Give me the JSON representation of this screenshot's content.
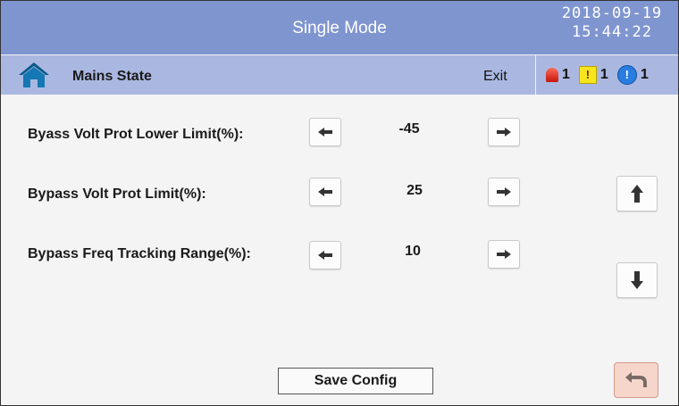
{
  "header": {
    "title": "Single Mode",
    "date": "2018-09-19",
    "time": "15:44:22"
  },
  "subheader": {
    "title": "Mains State",
    "exit_label": "Exit",
    "alarms": [
      {
        "icon": "red-alarm-icon",
        "count": "1"
      },
      {
        "icon": "yellow-warning-icon",
        "symbol": "!",
        "count": "1"
      },
      {
        "icon": "blue-info-icon",
        "symbol": "!",
        "count": "1"
      }
    ]
  },
  "settings": [
    {
      "label": "Byass Volt Prot Lower Limit(%):",
      "value": "-45"
    },
    {
      "label": "Bypass Volt Prot Limit(%):",
      "value": "25"
    },
    {
      "label": "Bypass Freq Tracking Range(%):",
      "value": "10"
    }
  ],
  "footer": {
    "save_label": "Save Config"
  },
  "colors": {
    "header_bg": "#7f95cf",
    "subheader_bg": "#aab8e1",
    "body_bg": "#f4f4f4",
    "back_button_bg": "#f6d6cb"
  }
}
